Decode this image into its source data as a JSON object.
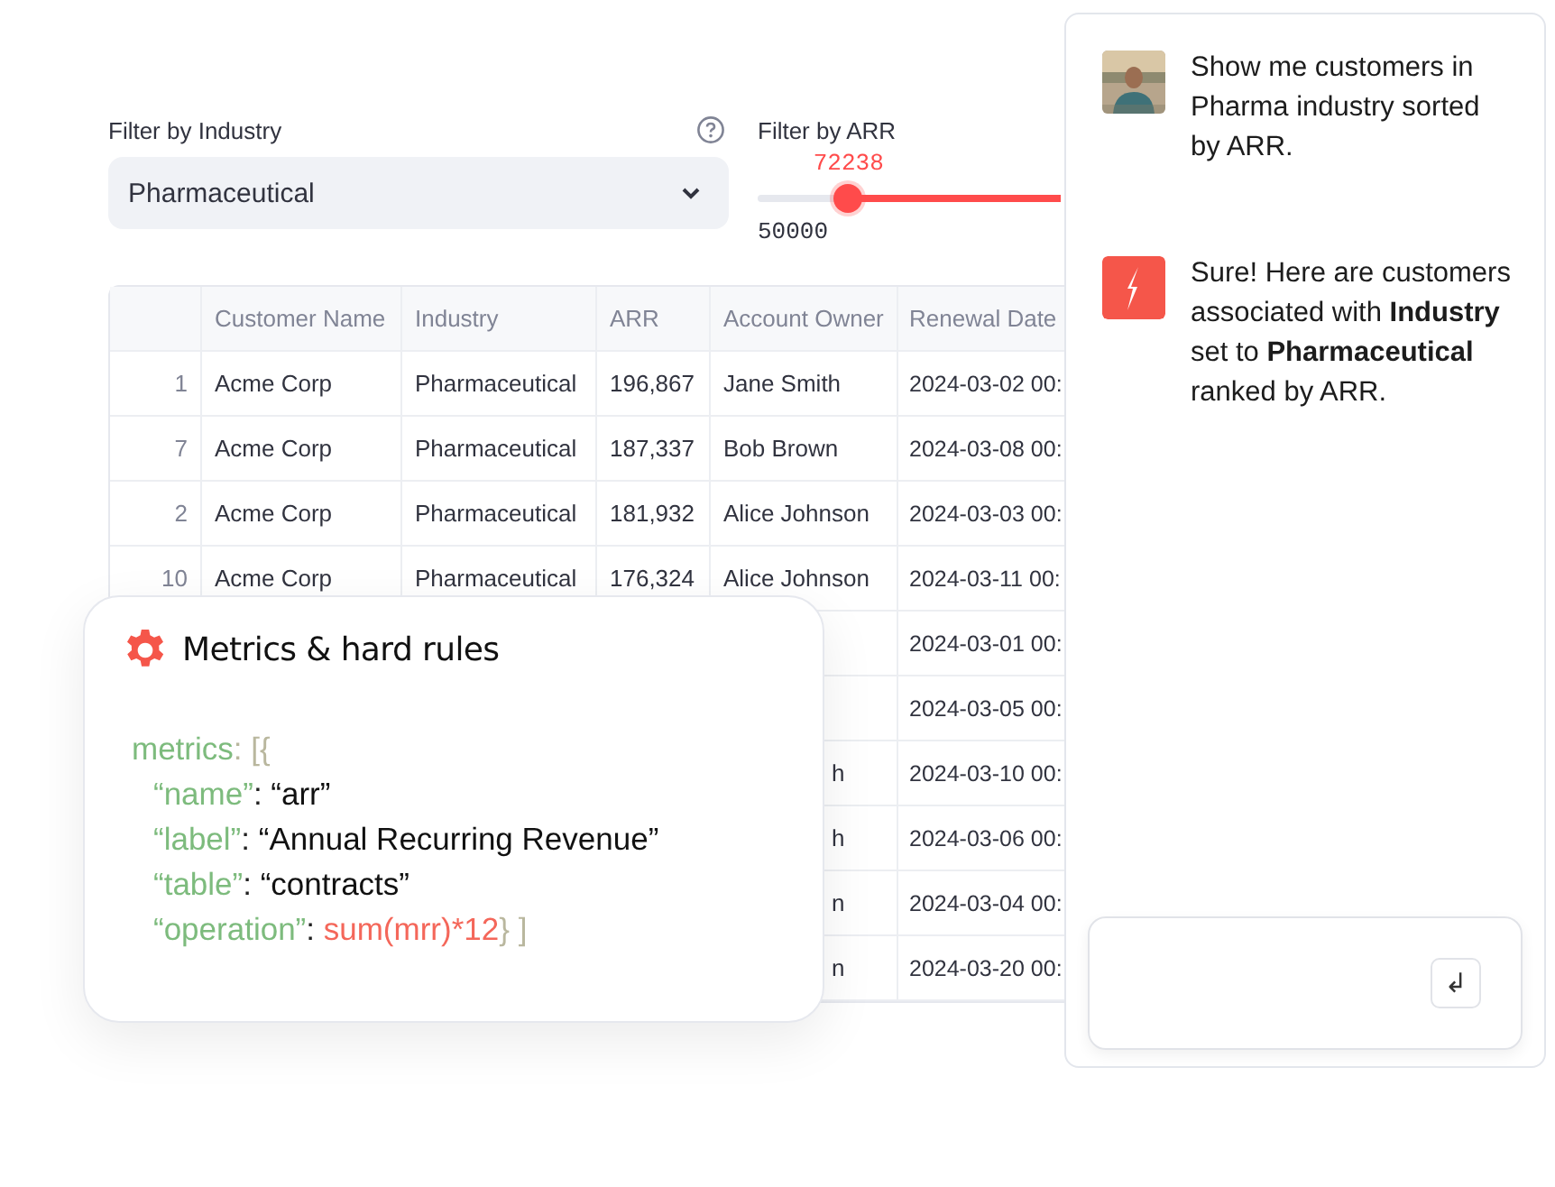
{
  "industry_filter": {
    "label": "Filter by Industry",
    "value": "Pharmaceutical"
  },
  "arr_filter": {
    "label": "Filter by ARR",
    "value": "72238",
    "min": "50000",
    "level": 0.3
  },
  "table": {
    "columns": [
      "",
      "Customer Name",
      "Industry",
      "ARR",
      "Account Owner",
      "Renewal Date"
    ],
    "rows": [
      {
        "cells": [
          "1",
          "Acme Corp",
          "Pharmaceutical",
          "196,867",
          "Jane Smith",
          "2024-03-02 00:"
        ]
      },
      {
        "cells": [
          "7",
          "Acme Corp",
          "Pharmaceutical",
          "187,337",
          "Bob Brown",
          "2024-03-08 00:"
        ]
      },
      {
        "cells": [
          "2",
          "Acme Corp",
          "Pharmaceutical",
          "181,932",
          "Alice Johnson",
          "2024-03-03 00:"
        ]
      },
      {
        "cells": [
          "10",
          "Acme Corp",
          "Pharmaceutical",
          "176,324",
          "Alice Johnson",
          "2024-03-11 00:"
        ]
      },
      {
        "cells": [
          "",
          "",
          "",
          "",
          "",
          "2024-03-01 00:"
        ]
      },
      {
        "cells": [
          "",
          "",
          "",
          "",
          "",
          "2024-03-05 00:"
        ]
      },
      {
        "cells": [
          "",
          "",
          "",
          "",
          "h",
          "2024-03-10 00:"
        ]
      },
      {
        "cells": [
          "",
          "",
          "",
          "",
          "h",
          "2024-03-06 00:"
        ]
      },
      {
        "cells": [
          "",
          "",
          "",
          "",
          "n",
          "2024-03-04 00:"
        ]
      },
      {
        "cells": [
          "",
          "",
          "",
          "",
          "n",
          "2024-03-20 00:"
        ]
      }
    ]
  },
  "metrics_card": {
    "title": "Metrics & hard rules",
    "code": [
      {
        "indent": false,
        "parts": [
          {
            "kind": "key",
            "text": "metrics"
          },
          {
            "kind": "faint",
            "text": ": [{"
          }
        ]
      },
      {
        "indent": true,
        "parts": [
          {
            "kind": "key",
            "text": "“name”"
          },
          {
            "kind": "punct",
            "text": ": "
          },
          {
            "kind": "value",
            "text": "“arr”"
          }
        ]
      },
      {
        "indent": true,
        "parts": [
          {
            "kind": "key",
            "text": "“label”"
          },
          {
            "kind": "punct",
            "text": ": "
          },
          {
            "kind": "value",
            "text": "“Annual Recurring Revenue”"
          }
        ]
      },
      {
        "indent": true,
        "parts": [
          {
            "kind": "key",
            "text": "“table”"
          },
          {
            "kind": "punct",
            "text": ": "
          },
          {
            "kind": "value",
            "text": "“contracts”"
          }
        ]
      },
      {
        "indent": true,
        "parts": [
          {
            "kind": "key",
            "text": "“operation”"
          },
          {
            "kind": "punct",
            "text": ": "
          },
          {
            "kind": "expr",
            "text": "sum(mrr)*12"
          },
          {
            "kind": "faint",
            "text": "} ]"
          }
        ]
      }
    ]
  },
  "chat": {
    "messages": [
      {
        "kind": "user",
        "text": "Show me customers in Pharma industry sorted by ARR."
      },
      {
        "kind": "bot",
        "text": "Sure! Here are customers associated with **Industry** set to **Pharmaceutical** ranked by ARR."
      }
    ],
    "send_key": "↲"
  }
}
